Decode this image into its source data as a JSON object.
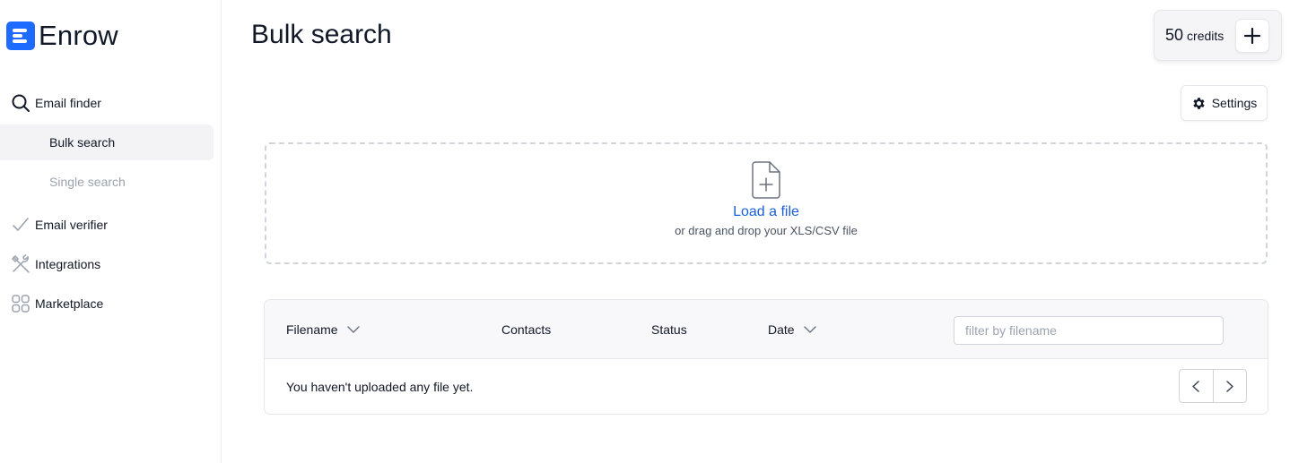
{
  "brand": {
    "name": "Enrow",
    "accent": "#1e6bff"
  },
  "sidebar": {
    "email_finder": {
      "label": "Email finder",
      "icon": "search-icon"
    },
    "sub_items": [
      {
        "label": "Bulk search",
        "active": true
      },
      {
        "label": "Single search",
        "active": false
      }
    ],
    "email_verifier": {
      "label": "Email verifier",
      "icon": "checkmark-icon"
    },
    "integrations": {
      "label": "Integrations",
      "icon": "tools-icon"
    },
    "marketplace": {
      "label": "Marketplace",
      "icon": "grid-icon"
    }
  },
  "header": {
    "title": "Bulk search",
    "credits": {
      "count": "50",
      "label": "credits"
    }
  },
  "settings": {
    "label": "Settings",
    "icon": "gear-icon"
  },
  "upload": {
    "link_text": "Load a file",
    "hint": "or drag and drop your XLS/CSV file",
    "link_color": "#1d5fd6"
  },
  "table": {
    "columns": {
      "filename": "Filename",
      "contacts": "Contacts",
      "status": "Status",
      "date": "Date"
    },
    "filter_placeholder": "filter by filename",
    "filter_value": "",
    "empty_message": "You haven't uploaded any file yet."
  }
}
